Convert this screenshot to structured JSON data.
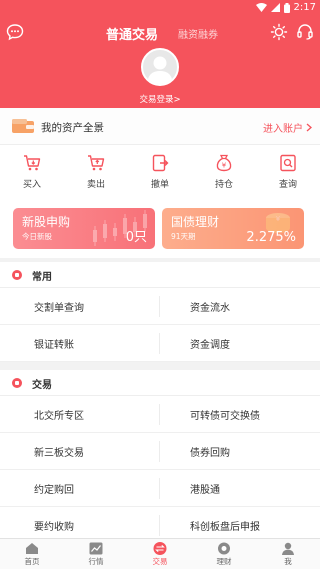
{
  "status": {
    "time": "2:17"
  },
  "header": {
    "tab_main": "普通交易",
    "tab_sub": "融资融券",
    "login": "交易登录>"
  },
  "assets": {
    "label": "我的资产全景",
    "enter": "进入账户"
  },
  "quick": [
    {
      "label": "买入",
      "icon": "buy-cart-icon"
    },
    {
      "label": "卖出",
      "icon": "sell-cart-icon"
    },
    {
      "label": "撤单",
      "icon": "cancel-order-icon"
    },
    {
      "label": "持仓",
      "icon": "money-bag-icon"
    },
    {
      "label": "查询",
      "icon": "query-icon"
    }
  ],
  "cards": {
    "ipo": {
      "title": "新股申购",
      "sub": "今日新股",
      "value": "0只"
    },
    "bond": {
      "title": "国债理财",
      "sub": "91天期",
      "value": "2.275%"
    }
  },
  "sections": {
    "common": {
      "title": "常用",
      "rows": [
        [
          "交割单查询",
          "资金流水"
        ],
        [
          "银证转账",
          "资金调度"
        ]
      ]
    },
    "trade": {
      "title": "交易",
      "rows": [
        [
          "北交所专区",
          "可转债可交换债"
        ],
        [
          "新三板交易",
          "债券回购"
        ],
        [
          "约定购回",
          "港股通"
        ],
        [
          "要约收购",
          "科创板盘后申报"
        ]
      ]
    }
  },
  "tabbar": [
    {
      "label": "首页",
      "icon": "home-icon"
    },
    {
      "label": "行情",
      "icon": "market-chart-icon"
    },
    {
      "label": "交易",
      "icon": "trade-icon",
      "active": true
    },
    {
      "label": "理财",
      "icon": "wealth-icon"
    },
    {
      "label": "我",
      "icon": "profile-icon"
    }
  ],
  "colors": {
    "brand": "#f5535c",
    "card1": "#f87178",
    "card2": "#fb9574"
  }
}
